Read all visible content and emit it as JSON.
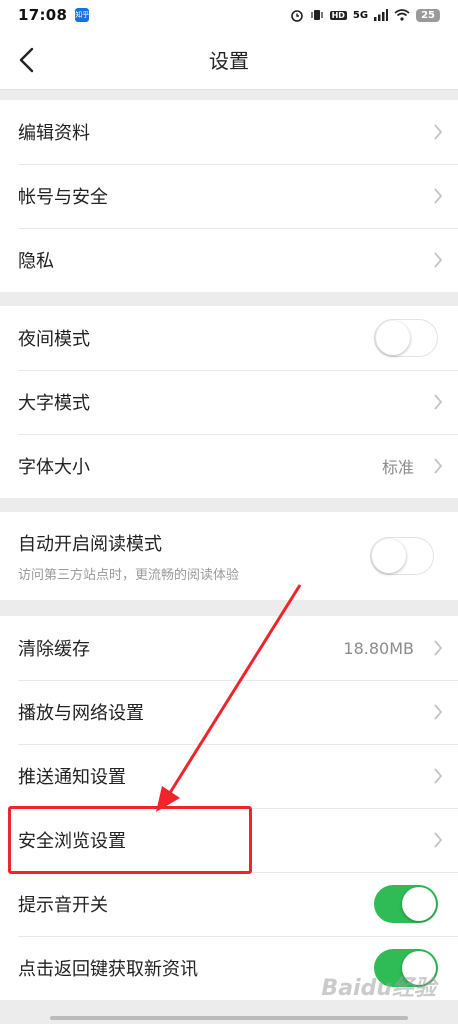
{
  "status_bar": {
    "time": "17:08",
    "app_badge": "知乎",
    "network": "5G",
    "hd": "HD",
    "battery": "25"
  },
  "header": {
    "title": "设置",
    "back_icon": "chevron-left-icon"
  },
  "group1": [
    {
      "label": "编辑资料"
    },
    {
      "label": "帐号与安全"
    },
    {
      "label": "隐私"
    }
  ],
  "group2": {
    "night_mode": {
      "label": "夜间模式",
      "enabled": false
    },
    "large_text": {
      "label": "大字模式"
    },
    "font_size": {
      "label": "字体大小",
      "value": "标准"
    }
  },
  "group3": {
    "auto_reader": {
      "label": "自动开启阅读模式",
      "sub": "访问第三方站点时，更流畅的阅读体验",
      "enabled": false
    }
  },
  "group4": {
    "clear_cache": {
      "label": "清除缓存",
      "value": "18.80MB"
    },
    "playback_network": {
      "label": "播放与网络设置"
    },
    "push": {
      "label": "推送通知设置"
    },
    "safe_browsing": {
      "label": "安全浏览设置"
    },
    "sound": {
      "label": "提示音开关",
      "enabled": true
    },
    "back_refresh": {
      "label": "点击返回键获取新资讯",
      "enabled": true
    }
  },
  "annotation": {
    "color": "#f0242a"
  },
  "watermark": "Baidu经验",
  "colors": {
    "toggle_on": "#2fbb55",
    "background": "#ececec"
  }
}
